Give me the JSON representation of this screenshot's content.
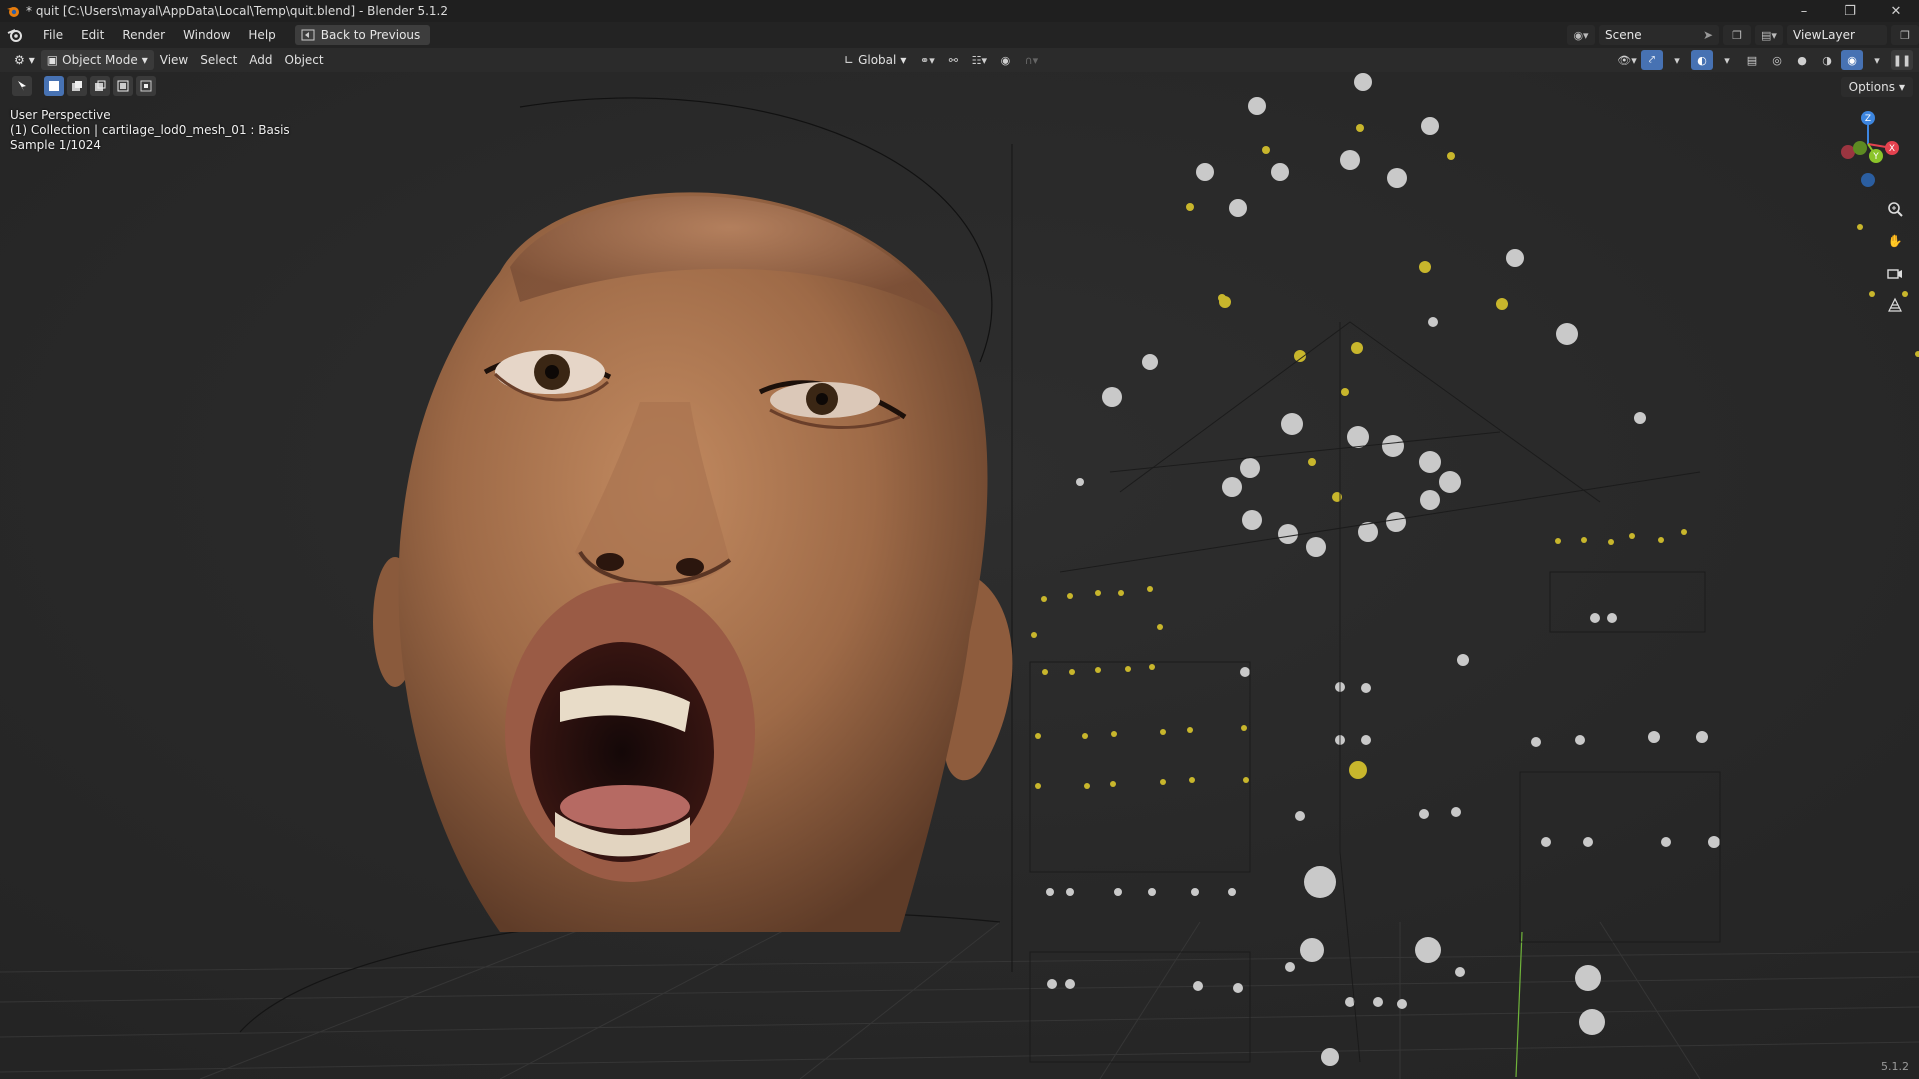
{
  "window": {
    "title": "* quit [C:\\Users\\mayal\\AppData\\Local\\Temp\\quit.blend] - Blender 5.1.2",
    "controls": [
      "minimize-icon",
      "restore-icon",
      "close-icon"
    ]
  },
  "menubar": {
    "items": [
      "File",
      "Edit",
      "Render",
      "Window",
      "Help"
    ],
    "back_label": "Back to Previous",
    "scene_name": "Scene",
    "view_layer": "ViewLayer"
  },
  "viewport_header": {
    "mode": "Object Mode",
    "menus": [
      "View",
      "Select",
      "Add",
      "Object"
    ],
    "transform_orientation": "Global"
  },
  "viewport": {
    "perspective_label": "User Perspective",
    "collection_label": "(1) Collection | cartilage_lod0_mesh_01 : Basis",
    "sample_label": "Sample 1/1024",
    "options_label": "Options",
    "version": "5.1.2"
  },
  "gizmo": {
    "axis_labels": [
      "Z",
      "Y",
      "X"
    ],
    "colors": {
      "x": "#e5424f",
      "y": "#8bc42a",
      "z": "#3d86e0"
    }
  },
  "colors": {
    "accent": "#4772b3",
    "selected_joint": "#c8b62c",
    "joint": "#c9c9c9",
    "skin": "#b57a52"
  }
}
